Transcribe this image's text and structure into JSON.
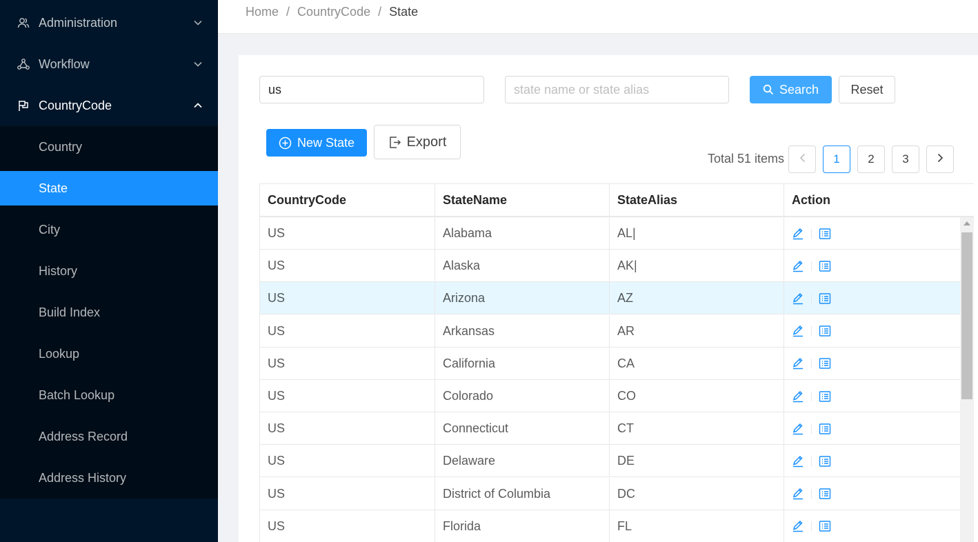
{
  "sidebar": {
    "items": [
      {
        "label": "Administration",
        "icon": "users-icon",
        "expanded": false
      },
      {
        "label": "Workflow",
        "icon": "workflow-icon",
        "expanded": false
      },
      {
        "label": "CountryCode",
        "icon": "flag-icon",
        "expanded": true
      }
    ],
    "subitems": [
      {
        "label": "Country"
      },
      {
        "label": "State",
        "active": true
      },
      {
        "label": "City"
      },
      {
        "label": "History"
      },
      {
        "label": "Build Index"
      },
      {
        "label": "Lookup"
      },
      {
        "label": "Batch Lookup"
      },
      {
        "label": "Address Record"
      },
      {
        "label": "Address History"
      }
    ]
  },
  "breadcrumb": {
    "items": [
      "Home",
      "CountryCode",
      "State"
    ],
    "separator": "/"
  },
  "filters": {
    "country_value": "us",
    "state_placeholder": "state name or state alias",
    "search_label": "Search",
    "reset_label": "Reset"
  },
  "toolbar": {
    "new_label": "New State",
    "export_label": "Export"
  },
  "pagination": {
    "total_text": "Total 51 items",
    "pages": [
      "1",
      "2",
      "3"
    ],
    "current": "1"
  },
  "table": {
    "columns": [
      "CountryCode",
      "StateName",
      "StateAlias",
      "Action"
    ],
    "rows": [
      {
        "country": "US",
        "name": "Alabama",
        "alias": "AL|"
      },
      {
        "country": "US",
        "name": "Alaska",
        "alias": "AK|"
      },
      {
        "country": "US",
        "name": "Arizona",
        "alias": "AZ"
      },
      {
        "country": "US",
        "name": "Arkansas",
        "alias": "AR"
      },
      {
        "country": "US",
        "name": "California",
        "alias": "CA"
      },
      {
        "country": "US",
        "name": "Colorado",
        "alias": "CO"
      },
      {
        "country": "US",
        "name": "Connecticut",
        "alias": "CT"
      },
      {
        "country": "US",
        "name": "Delaware",
        "alias": "DE"
      },
      {
        "country": "US",
        "name": "District of Columbia",
        "alias": "DC"
      },
      {
        "country": "US",
        "name": "Florida",
        "alias": "FL"
      }
    ],
    "highlighted_row": "Arizona",
    "row_actions": [
      "edit-icon",
      "detail-list-icon"
    ]
  },
  "colors": {
    "sidebar_bg": "#001529",
    "submenu_bg": "#000c17",
    "primary": "#1890ff",
    "row_highlight": "#e6f7ff"
  }
}
